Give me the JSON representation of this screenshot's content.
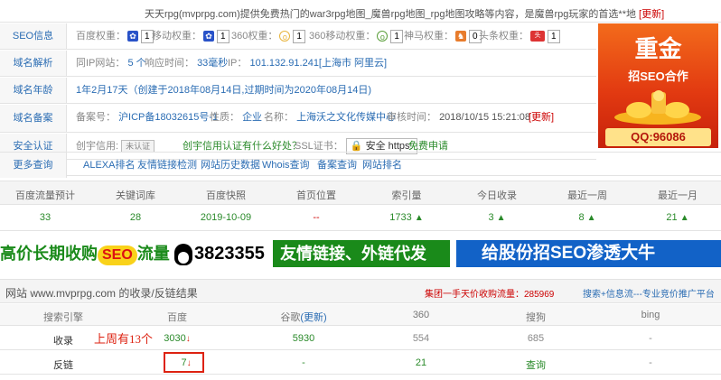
{
  "header": {
    "description": "天天rpg(mvprpg.com)提供免费热门的war3rpg地图_魔兽rpg地图_rpg地图攻略等内容，是魔兽rpg玩家的首选**地",
    "update_label": "[更新]"
  },
  "seo_info": {
    "label": "SEO信息",
    "baidu_weight_label": "百度权重：",
    "baidu_weight": "1",
    "mobile_weight_label": "移动权重：",
    "mobile_weight": "1",
    "weight360_label": "360权重：",
    "weight360": "1",
    "mobile360_label": "360移动权重：",
    "mobile360": "1",
    "shenma_label": "神马权重：",
    "shenma": "0",
    "toutiao_label": "头条权重：",
    "toutiao": "1"
  },
  "domain_resolve": {
    "label": "域名解析",
    "ip_sites_label": "同IP网站：",
    "ip_sites": "5 个",
    "response_label": "响应时间：",
    "response": "33毫秒",
    "ip_label": "IP：",
    "ip": "101.132.91.241[上海市 阿里云]"
  },
  "domain_age": {
    "label": "域名年龄",
    "value": "1年2月17天（创建于2018年08月14日,过期时间为2020年08月14日)"
  },
  "domain_record": {
    "label": "域名备案",
    "record_no_label": "备案号：",
    "record_no": "沪ICP备18032615号-1",
    "nature_label": "性质：",
    "nature": "企业",
    "name_label": "名称：",
    "name": "上海沃之文化传媒中心",
    "audit_label": "审核时间：",
    "audit": "2018/10/15 15:21:08",
    "update": "[更新]"
  },
  "security": {
    "label": "安全认证",
    "credit_label": "创宇信用:",
    "credit_badge": "未认证",
    "credit_question": "创宇信用认证有什么好处？",
    "ssl_label": "SSL证书：",
    "ssl_badge": "安全 https:",
    "ssl_apply": "免费申请"
  },
  "more": {
    "label": "更多查询",
    "links": [
      "ALEXA排名",
      "友情链接检测",
      "网站历史数据",
      "Whois查询",
      "备案查询",
      "网站排名"
    ]
  },
  "ad_right": {
    "title": "重金",
    "subtitle": "招SEO合作",
    "contact": "QQ:96086"
  },
  "stats": {
    "headers": [
      "百度流量预计",
      "关键词库",
      "百度快照",
      "首页位置",
      "索引量",
      "今日收录",
      "最近一周",
      "最近一月"
    ],
    "values": [
      "33",
      "28",
      "2019-10-09",
      "--",
      "1733",
      "3",
      "8",
      "21"
    ],
    "trend_up": "▲"
  },
  "banners": {
    "b1_text": "高价长期收购",
    "b1_seo": "SEO",
    "b1_tail": "流量",
    "b2_text": "3823355",
    "b3_text": "友情链接、外链代发",
    "b4_text": "给股份招SEO渗透大牛"
  },
  "index_table": {
    "title": "网站 www.mvprpg.com 的收录/反链结果",
    "promo_prefix": "集团一手天价收购流量：",
    "promo_number": "285969",
    "promo2": "搜索+信息流---专业竞价推广平台",
    "headers": [
      "搜索引擎",
      "百度",
      "谷歌",
      "(更新)",
      "360",
      "搜狗",
      "bing"
    ],
    "rows": [
      {
        "name": "收录",
        "baidu": "3030",
        "google": "5930",
        "s360": "554",
        "sogou": "685",
        "bing": "-"
      },
      {
        "name": "反链",
        "baidu": "7",
        "google": "-",
        "s360": "21",
        "sogou": "查询",
        "bing": "-"
      }
    ],
    "annotation": "上周有13个",
    "arrow_down": "↓"
  },
  "colors": {
    "link": "#2a6cb3",
    "alert": "#cc0000",
    "up": "#2a8a2a",
    "annotation": "#dd2211"
  }
}
